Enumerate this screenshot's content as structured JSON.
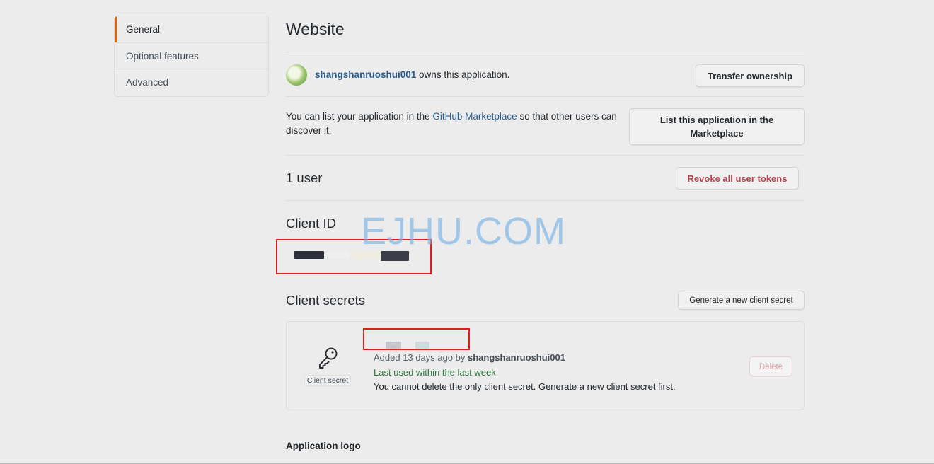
{
  "sidebar": {
    "items": [
      {
        "label": "General",
        "active": true
      },
      {
        "label": "Optional features",
        "active": false
      },
      {
        "label": "Advanced",
        "active": false
      }
    ]
  },
  "main": {
    "title": "Website",
    "owner": {
      "username": "shangshanruoshui001",
      "suffix": " owns this application.",
      "transfer_button": "Transfer ownership"
    },
    "marketplace": {
      "text_before": "You can list your application in the ",
      "link": "GitHub Marketplace",
      "text_after": " so that other users can discover it.",
      "button": "List this application in the Marketplace"
    },
    "users": {
      "count_label": "1 user",
      "revoke_button": "Revoke all user tokens"
    },
    "client_id": {
      "heading": "Client ID"
    },
    "client_secrets": {
      "heading": "Client secrets",
      "generate_button": "Generate a new client secret",
      "secret": {
        "icon_label": "Client secret",
        "added_prefix": "Added 13 days ago by ",
        "added_by": "shangshanruoshui001",
        "last_used": "Last used within the last week",
        "note": "You cannot delete the only client secret. Generate a new client secret first.",
        "delete_button": "Delete"
      }
    },
    "application_logo": {
      "heading": "Application logo"
    }
  },
  "watermark": "EJHU.COM",
  "colors": {
    "accent": "#e36209",
    "link": "#2a5f8f",
    "danger": "#b6444d",
    "success": "#2f7a3d",
    "annotation_red": "#e0201e"
  }
}
